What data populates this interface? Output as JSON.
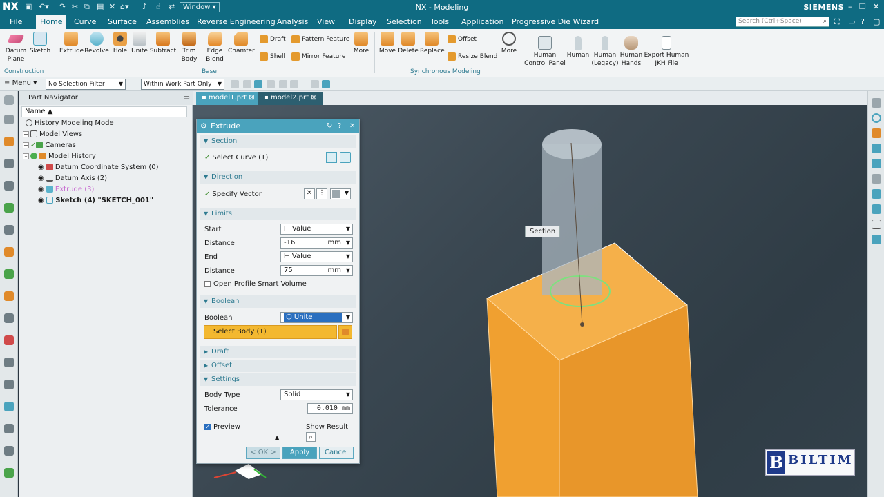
{
  "titlebar": {
    "logo": "NX",
    "window_menu": "Window ▾",
    "title": "NX - Modeling",
    "brand": "SIEMENS"
  },
  "menu_tabs": [
    "File",
    "Home",
    "Curve",
    "Surface",
    "Assemblies",
    "Reverse Engineering",
    "Analysis",
    "View",
    "Display",
    "Selection",
    "Tools",
    "Application",
    "Progressive Die Wizard"
  ],
  "active_tab": "Home",
  "search": {
    "placeholder": "Search (Ctrl+Space)"
  },
  "ribbon": {
    "datum_plane": "Datum\nPlane",
    "sketch": "Sketch",
    "extrude": "Extrude",
    "revolve": "Revolve",
    "hole": "Hole",
    "unite": "Unite",
    "subtract": "Subtract",
    "trim_body": "Trim\nBody",
    "edge_blend": "Edge\nBlend",
    "chamfer": "Chamfer",
    "draft": "Draft",
    "shell": "Shell",
    "pattern_feature": "Pattern Feature",
    "mirror_feature": "Mirror Feature",
    "more1": "More",
    "move": "Move",
    "delete": "Delete",
    "replace": "Replace",
    "offset": "Offset",
    "resize_blend": "Resize Blend",
    "more2": "More",
    "human_control_panel": "Human\nControl Panel",
    "human": "Human",
    "human_legacy": "Human\n(Legacy)",
    "human_hands": "Human\nHands",
    "export_human": "Export Human\nJKH File",
    "group_construction": "Construction",
    "group_base": "Base",
    "group_sync": "Synchronous Modeling"
  },
  "toolbar": {
    "menu": "Menu",
    "selection_filter": "No Selection Filter",
    "scope": "Within Work Part Only"
  },
  "navigator": {
    "title": "Part Navigator",
    "column_name": "Name",
    "items": [
      {
        "label": "History Modeling Mode"
      },
      {
        "label": "Model Views"
      },
      {
        "label": "Cameras"
      },
      {
        "label": "Model History"
      },
      {
        "label": "Datum Coordinate System (0)"
      },
      {
        "label": "Datum Axis (2)"
      },
      {
        "label": "Extrude (3)"
      },
      {
        "label": "Sketch (4) \"SKETCH_001\""
      }
    ]
  },
  "doc_tabs": [
    "model1.prt",
    "model2.prt"
  ],
  "dialog": {
    "title": "Extrude",
    "section": "Section",
    "select_curve": "Select Curve (1)",
    "direction": "Direction",
    "specify_vector": "Specify Vector",
    "limits": "Limits",
    "start_label": "Start",
    "start_value": "Value",
    "distance_label": "Distance",
    "start_distance": "-16",
    "unit": "mm",
    "end_label": "End",
    "end_value": "Value",
    "end_distance": "75",
    "open_profile": "Open Profile Smart Volume",
    "boolean_section": "Boolean",
    "boolean_label": "Boolean",
    "boolean_value": "Unite",
    "select_body": "Select Body (1)",
    "draft": "Draft",
    "offset": "Offset",
    "settings": "Settings",
    "body_type_label": "Body Type",
    "body_type_value": "Solid",
    "tolerance_label": "Tolerance",
    "tolerance_value": "0.010 mm",
    "preview": "Preview",
    "show_result": "Show Result",
    "ok": "< OK >",
    "apply": "Apply",
    "cancel": "Cancel"
  },
  "viewport": {
    "section_tooltip": "Section"
  },
  "watermark": {
    "text": "BILTIM"
  },
  "colors": {
    "titlebar": "#0f6b82",
    "dialog_header": "#4aa3bd",
    "body_orange": "#f0a030",
    "select_highlight": "#f3b830"
  }
}
